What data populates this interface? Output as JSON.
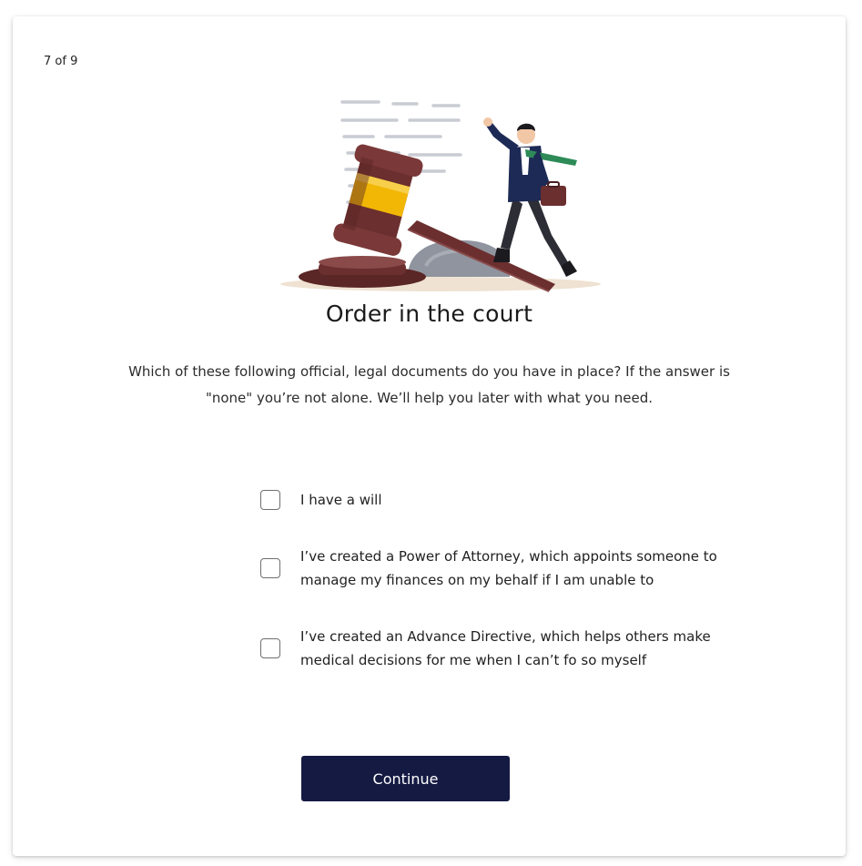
{
  "progress": {
    "label": "7 of 9",
    "current": 7,
    "total": 9
  },
  "illustration": {
    "name": "gavel-and-businessman-illustration"
  },
  "title": "Order in the court",
  "description": "Which of these following official, legal documents do you have in place? If the answer is \"none\" you’re not alone. We’ll help you later with what you need.",
  "options": [
    {
      "label": "I have a will",
      "checked": false
    },
    {
      "label": "I’ve created a Power of Attorney, which appoints someone to manage my finances on my behalf if I am unable to",
      "checked": false
    },
    {
      "label": "I’ve created an Advance Directive, which helps others make medical decisions for me when I can’t fo so myself",
      "checked": false
    }
  ],
  "continue_label": "Continue",
  "colors": {
    "button_bg": "#151a43",
    "button_text": "#ffffff",
    "gavel_wood": "#6b2f2f",
    "gavel_band": "#f2b705",
    "suit": "#1d2a55",
    "tie": "#2e8b57"
  }
}
